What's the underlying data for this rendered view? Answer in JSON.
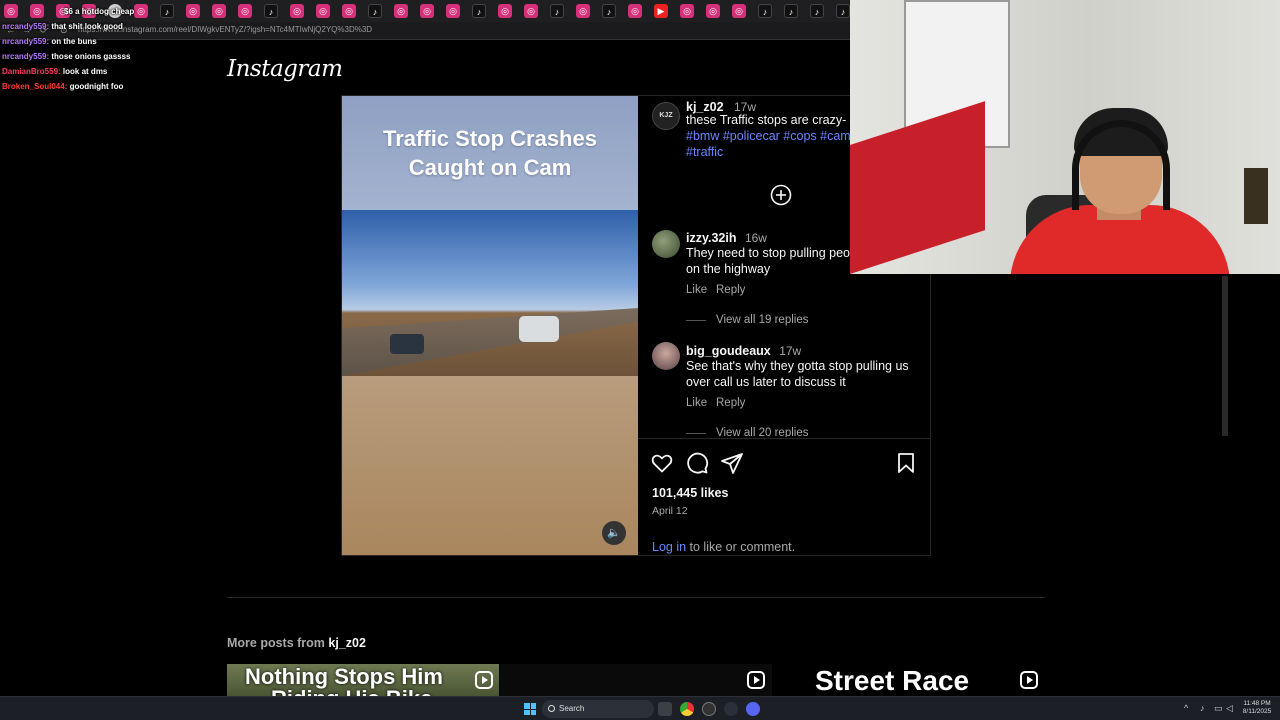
{
  "browser": {
    "url": "https://www.instagram.com/reel/DIWgkvENTyZ/?igsh=NTc4MTIwNjQ2YQ%3D%3D",
    "tabs": [
      "ig",
      "ig",
      "ig",
      "ig",
      "gl",
      "ig",
      "tt",
      "ig",
      "ig",
      "ig",
      "tt",
      "ig",
      "ig",
      "ig",
      "tt",
      "ig",
      "ig",
      "ig",
      "tt",
      "ig",
      "ig",
      "tt",
      "ig",
      "tt",
      "ig",
      "yt",
      "ig",
      "ig",
      "ig",
      "tt",
      "tt",
      "tt",
      "tt",
      "tt",
      "tt",
      "tt",
      "tt",
      "tt",
      "ig",
      "ig",
      "tt",
      "tt"
    ]
  },
  "chat": [
    {
      "user": "",
      "user_color": "#7fd25a",
      "message": "$6 a hotdog cheap"
    },
    {
      "user": "nrcandy559:",
      "user_color": "#b57aff",
      "message": "that shit look good"
    },
    {
      "user": "nrcandy559:",
      "user_color": "#b57aff",
      "message": "on the buns"
    },
    {
      "user": "nrcandy559:",
      "user_color": "#b57aff",
      "message": "those onions gassss"
    },
    {
      "user": "DamianBro559:",
      "user_color": "#ff3b5c",
      "message": "look at dms"
    },
    {
      "user": "Broken_Soul044:",
      "user_color": "#ff3b3b",
      "message": "goodnight foo"
    }
  ],
  "header": {
    "logo": "Instagram"
  },
  "post": {
    "media_caption": "Traffic Stop Crashes Caught on Cam",
    "author": {
      "username": "kj_z02",
      "age": "17w",
      "avatar_text": "KJZ"
    },
    "caption_text": "these Traffic stops are crazy-",
    "caption_tags": [
      "#",
      "#bmw",
      "#policecar",
      "#cops",
      "#cam",
      "#traffic"
    ],
    "comments": [
      {
        "username": "izzy.32ih",
        "age": "16w",
        "text1": "They need to stop pulling peo",
        "text2": "on the highway",
        "like": "Like",
        "reply": "Reply",
        "replies": "View all 19 replies"
      },
      {
        "username": "big_goudeaux",
        "age": "17w",
        "text1": "See that's why they gotta stop pulling us",
        "text2": "over call us later to discuss it",
        "like": "Like",
        "reply": "Reply",
        "replies": "View all 20 replies"
      }
    ],
    "likes": "101,445 likes",
    "date": "April 12",
    "login_link": "Log in",
    "login_rest": " to like or comment."
  },
  "more_posts": {
    "prefix": "More posts from ",
    "username": "kj_z02",
    "thumbs": [
      {
        "text": "Nothing Stops Him",
        "text2": "Riding His Bike"
      },
      {
        "text": ""
      },
      {
        "text": "Street Race"
      }
    ]
  },
  "taskbar": {
    "search": "Search",
    "time": "11:48 PM",
    "date": "8/11/2025"
  }
}
